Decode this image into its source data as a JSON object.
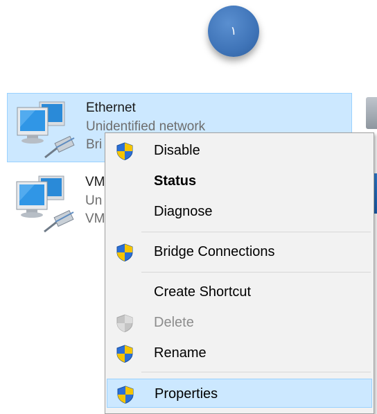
{
  "badge": {
    "text": "١"
  },
  "network": [
    {
      "name": "Ethernet",
      "status": "Unidentified network",
      "device": "Bri"
    },
    {
      "name": "VM",
      "status": "Un",
      "device": "VM"
    }
  ],
  "menu": {
    "items": [
      {
        "label": "Disable",
        "icon": "uac-shield-icon"
      },
      {
        "label": "Status",
        "bold": true
      },
      {
        "label": "Diagnose"
      },
      {
        "label": "Bridge Connections",
        "icon": "uac-shield-icon"
      },
      {
        "label": "Create Shortcut"
      },
      {
        "label": "Delete",
        "icon": "uac-shield-icon",
        "disabled": true
      },
      {
        "label": "Rename",
        "icon": "uac-shield-icon"
      },
      {
        "label": "Properties",
        "icon": "uac-shield-icon",
        "highlighted": true
      }
    ]
  }
}
